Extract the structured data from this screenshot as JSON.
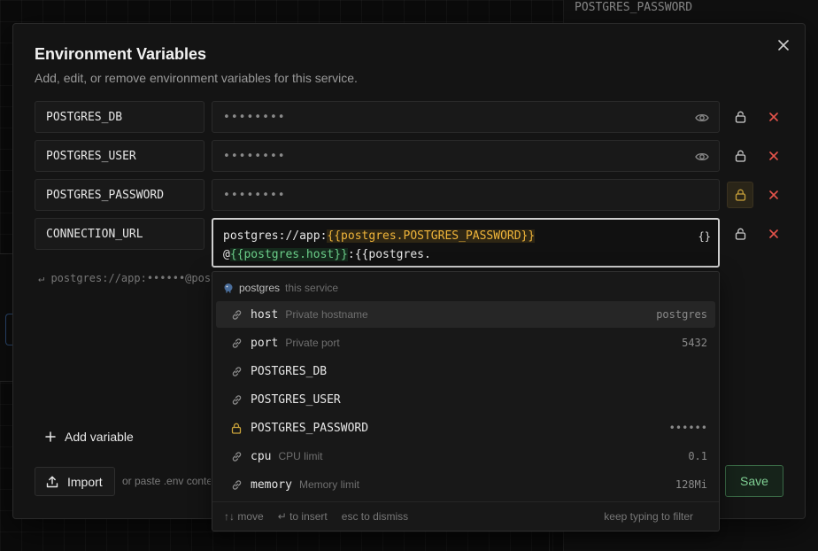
{
  "background": {
    "panel_text": "POSTGRES_PASSWORD"
  },
  "modal": {
    "title": "Environment Variables",
    "subtitle": "Add, edit, or remove environment variables for this service.",
    "rows": [
      {
        "key": "POSTGRES_DB",
        "masked": "••••••••"
      },
      {
        "key": "POSTGRES_USER",
        "masked": "••••••••"
      },
      {
        "key": "POSTGRES_PASSWORD",
        "masked": "••••••••"
      },
      {
        "key": "CONNECTION_URL"
      }
    ],
    "editor": {
      "line1_prefix": "postgres://app:",
      "line1_ref": "{{postgres.POSTGRES_PASSWORD}}",
      "line2_at": "@",
      "line2_ref": "{{postgres.host}}",
      "line2_suffix": ":{{postgres.",
      "brace_label": "{}"
    },
    "preview": "↵ postgres://app:••••••@postgres",
    "add_variable": "Add variable",
    "import_label": "Import",
    "paste_hint": "or paste .env contents",
    "save_label": "Save"
  },
  "autocomplete": {
    "service": "postgres",
    "service_note": "this service",
    "items": [
      {
        "name": "host",
        "desc": "Private hostname",
        "value": "postgres",
        "icon": "link-icon"
      },
      {
        "name": "port",
        "desc": "Private port",
        "value": "5432",
        "icon": "link-icon"
      },
      {
        "name": "POSTGRES_DB",
        "desc": "",
        "value": "",
        "icon": "link-icon"
      },
      {
        "name": "POSTGRES_USER",
        "desc": "",
        "value": "",
        "icon": "link-icon"
      },
      {
        "name": "POSTGRES_PASSWORD",
        "desc": "",
        "value": "••••••",
        "icon": "lock-icon"
      },
      {
        "name": "cpu",
        "desc": "CPU limit",
        "value": "0.1",
        "icon": "link-icon"
      },
      {
        "name": "memory",
        "desc": "Memory limit",
        "value": "128Mi",
        "icon": "link-icon"
      }
    ],
    "footer": {
      "move": "↑↓ move",
      "insert": "↵ to insert",
      "dismiss": "esc to dismiss",
      "filter": "keep typing to filter"
    }
  },
  "colors": {
    "accent_green": "#7fcf93",
    "danger": "#e5534b",
    "lock_amber": "#c9a23a",
    "ref_password": "#f0b53a",
    "ref_host": "#6ccf8a"
  }
}
